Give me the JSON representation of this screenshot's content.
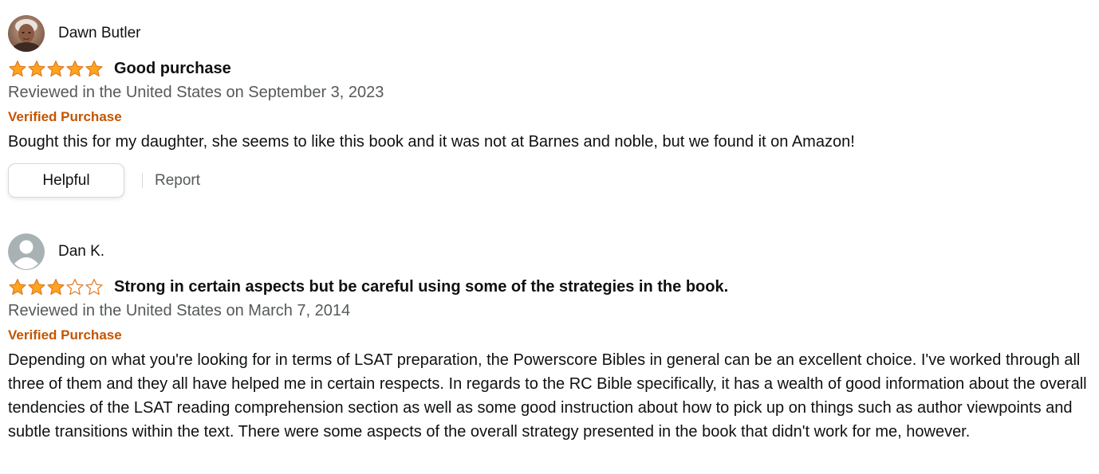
{
  "colors": {
    "star": "#ffa41c",
    "star_outline": "#de7921",
    "verified": "#c45500",
    "muted_text": "#565959",
    "text": "#0f1111"
  },
  "reviews": [
    {
      "reviewer": "Dawn Butler",
      "avatar": "photo-avatar",
      "rating": 5,
      "rating_max": 5,
      "title": "Good purchase",
      "date": "Reviewed in the United States on September 3, 2023",
      "verified": "Verified Purchase",
      "body": "Bought this for my daughter, she seems to like this book and it was not at Barnes and noble, but we found it on Amazon!",
      "helpful_label": "Helpful",
      "report_label": "Report"
    },
    {
      "reviewer": "Dan K.",
      "avatar": "default-user-avatar",
      "rating": 3,
      "rating_max": 5,
      "title": "Strong in certain aspects but be careful using some of the strategies in the book.",
      "date": "Reviewed in the United States on March 7, 2014",
      "verified": "Verified Purchase",
      "body": "Depending on what you're looking for in terms of LSAT preparation, the Powerscore Bibles in general can be an excellent choice. I've worked through all three of them and they all have helped me in certain respects. In regards to the RC Bible specifically, it has a wealth of good information about the overall tendencies of the LSAT reading comprehension section as well as some good instruction about how to pick up on things such as author viewpoints and subtle transitions within the text. There were some aspects of the overall strategy presented in the book that didn't work for me, however."
    }
  ]
}
